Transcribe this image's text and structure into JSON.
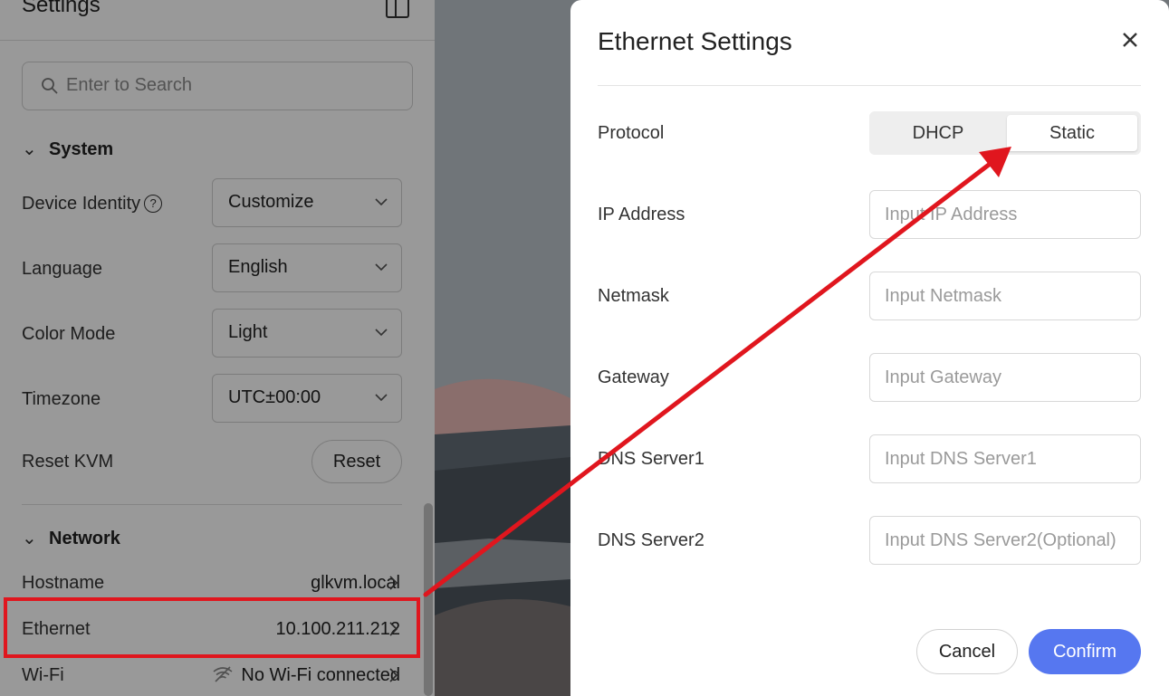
{
  "settings": {
    "title": "Settings",
    "search_placeholder": "Enter to Search",
    "system": {
      "heading": "System",
      "device_identity": {
        "label": "Device Identity",
        "value": "Customize"
      },
      "language": {
        "label": "Language",
        "value": "English"
      },
      "color_mode": {
        "label": "Color Mode",
        "value": "Light"
      },
      "timezone": {
        "label": "Timezone",
        "value": "UTC±00:00"
      },
      "reset_kvm": {
        "label": "Reset KVM",
        "button": "Reset"
      }
    },
    "network": {
      "heading": "Network",
      "hostname": {
        "label": "Hostname",
        "value": "glkvm.local"
      },
      "ethernet": {
        "label": "Ethernet",
        "value": "10.100.211.212"
      },
      "wifi": {
        "label": "Wi-Fi",
        "value": "No Wi-Fi connected"
      }
    }
  },
  "modal": {
    "title": "Ethernet Settings",
    "protocol": {
      "label": "Protocol",
      "options": [
        "DHCP",
        "Static"
      ],
      "selected": "Static"
    },
    "fields": {
      "ip": {
        "label": "IP Address",
        "placeholder": "Input IP Address"
      },
      "netmask": {
        "label": "Netmask",
        "placeholder": "Input Netmask"
      },
      "gateway": {
        "label": "Gateway",
        "placeholder": "Input Gateway"
      },
      "dns1": {
        "label": "DNS Server1",
        "placeholder": "Input DNS Server1"
      },
      "dns2": {
        "label": "DNS Server2",
        "placeholder": "Input DNS Server2(Optional)"
      }
    },
    "cancel_label": "Cancel",
    "confirm_label": "Confirm"
  },
  "colors": {
    "accent": "#5677f0",
    "annotation": "#e0161e"
  }
}
